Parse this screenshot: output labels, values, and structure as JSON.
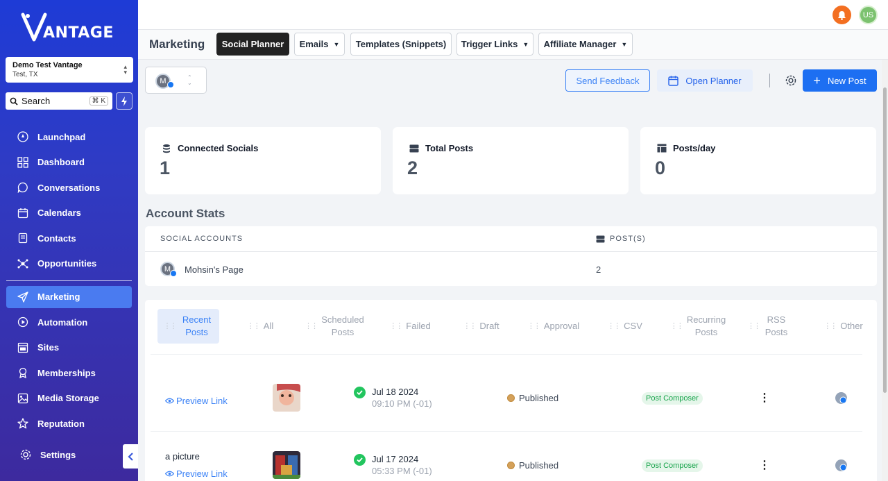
{
  "brand": {
    "logo_text": "ANTAGE"
  },
  "location": {
    "name": "Demo Test Vantage",
    "sub": "Test, TX"
  },
  "search": {
    "label": "Search",
    "shortcut": "⌘ K"
  },
  "sidebar": {
    "items": [
      {
        "label": "Launchpad",
        "icon": "rocket-icon"
      },
      {
        "label": "Dashboard",
        "icon": "grid-icon"
      },
      {
        "label": "Conversations",
        "icon": "chat-icon"
      },
      {
        "label": "Calendars",
        "icon": "calendar-icon"
      },
      {
        "label": "Contacts",
        "icon": "contacts-icon"
      },
      {
        "label": "Opportunities",
        "icon": "opportunities-icon"
      },
      {
        "label": "Marketing",
        "icon": "send-icon",
        "active": true
      },
      {
        "label": "Automation",
        "icon": "automation-icon"
      },
      {
        "label": "Sites",
        "icon": "sites-icon"
      },
      {
        "label": "Memberships",
        "icon": "membership-icon"
      },
      {
        "label": "Media Storage",
        "icon": "image-icon"
      },
      {
        "label": "Reputation",
        "icon": "star-icon"
      }
    ],
    "settings_label": "Settings"
  },
  "header": {
    "avatar_initials": "US"
  },
  "page": {
    "title": "Marketing",
    "tabs": [
      {
        "label": "Social Planner",
        "active": true
      },
      {
        "label": "Emails",
        "dropdown": true
      },
      {
        "label": "Templates (Snippets)"
      },
      {
        "label": "Trigger Links",
        "dropdown": true
      },
      {
        "label": "Affiliate Manager",
        "dropdown": true
      }
    ]
  },
  "toolbar": {
    "account_initial": "M",
    "feedback_label": "Send Feedback",
    "planner_label": "Open Planner",
    "new_post_label": "New Post"
  },
  "stats": [
    {
      "label": "Connected Socials",
      "value": "1",
      "icon": "database-icon"
    },
    {
      "label": "Total Posts",
      "value": "2",
      "icon": "server-icon"
    },
    {
      "label": "Posts/day",
      "value": "0",
      "icon": "layout-icon"
    }
  ],
  "account_stats": {
    "title": "Account Stats",
    "columns": [
      "SOCIAL ACCOUNTS",
      "POST(S)"
    ],
    "rows": [
      {
        "initial": "M",
        "name": "Mohsin's Page",
        "posts": "2"
      }
    ]
  },
  "post_tabs": [
    {
      "label": "Recent Posts",
      "active": true
    },
    {
      "label": "All"
    },
    {
      "label": "Scheduled Posts"
    },
    {
      "label": "Failed"
    },
    {
      "label": "Draft"
    },
    {
      "label": "Approval"
    },
    {
      "label": "CSV"
    },
    {
      "label": "Recurring Posts"
    },
    {
      "label": "RSS Posts"
    },
    {
      "label": "Other"
    }
  ],
  "posts": [
    {
      "text": "",
      "preview_label": "Preview Link",
      "date": "Jul 18 2024",
      "time": "09:10 PM (-01)",
      "status": "Published",
      "source": "Post Composer"
    },
    {
      "text": "a picture",
      "preview_label": "Preview Link",
      "date": "Jul 17 2024",
      "time": "05:33 PM (-01)",
      "status": "Published",
      "source": "Post Composer"
    }
  ],
  "colors": {
    "primary": "#1d6ff2",
    "sidebar_top": "#1e3bd6",
    "sidebar_bottom": "#3d2a9e",
    "success": "#22c55e",
    "bell": "#f36f21"
  }
}
